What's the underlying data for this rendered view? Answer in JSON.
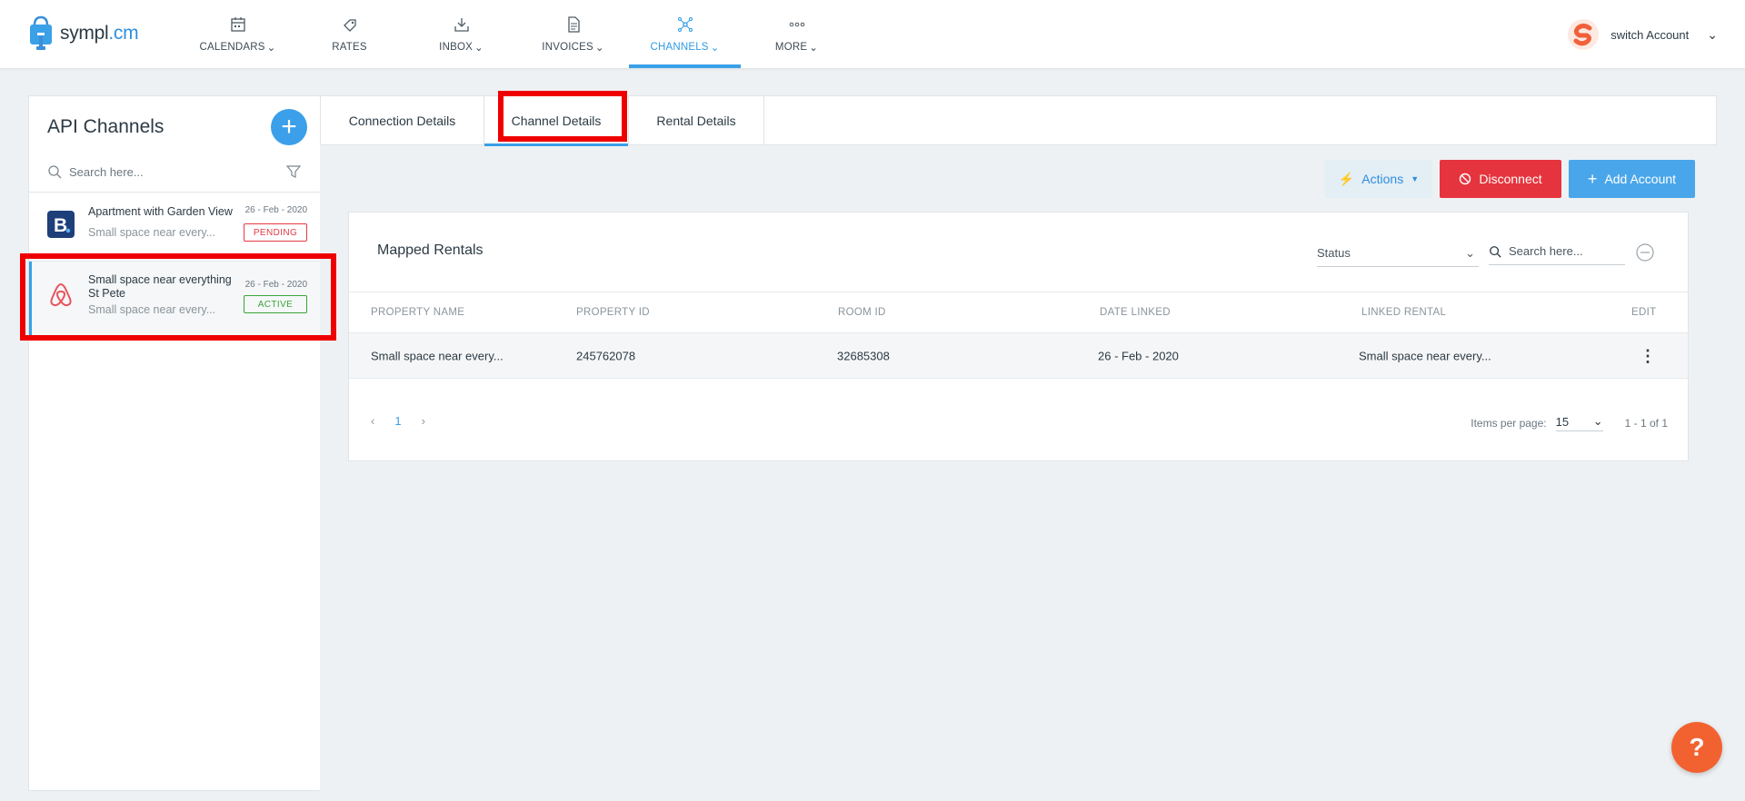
{
  "brand": {
    "name_main": "sympl",
    "name_suffix": ".cm"
  },
  "nav": [
    {
      "label": "CALENDARS",
      "icon": "calendar-icon",
      "dropdown": true,
      "active": false
    },
    {
      "label": "RATES",
      "icon": "tag-icon",
      "dropdown": false,
      "active": false
    },
    {
      "label": "INBOX",
      "icon": "inbox-download-icon",
      "dropdown": true,
      "active": false
    },
    {
      "label": "INVOICES",
      "icon": "document-icon",
      "dropdown": true,
      "active": false
    },
    {
      "label": "CHANNELS",
      "icon": "network-icon",
      "dropdown": true,
      "active": true
    },
    {
      "label": "MORE",
      "icon": "more-dots-icon",
      "dropdown": true,
      "active": false
    }
  ],
  "account": {
    "label": "switch Account"
  },
  "sidebar": {
    "title": "API Channels",
    "search_placeholder": "Search here...",
    "channels": [
      {
        "name": "Apartment with Garden View",
        "subtitle": "Small space near every...",
        "date": "26 - Feb - 2020",
        "status": "PENDING",
        "icon": "booking-icon"
      },
      {
        "name": "Small space near everything St Pete",
        "subtitle": "Small space near every...",
        "date": "26 - Feb - 2020",
        "status": "ACTIVE",
        "icon": "airbnb-icon"
      }
    ]
  },
  "tabs": [
    "Connection Details",
    "Channel Details",
    "Rental Details"
  ],
  "toolbar": {
    "actions": "Actions",
    "disconnect": "Disconnect",
    "add_account": "Add Account"
  },
  "mapped": {
    "title": "Mapped Rentals",
    "status_label": "Status",
    "search_placeholder": "Search here...",
    "columns": [
      "PROPERTY NAME",
      "PROPERTY ID",
      "ROOM ID",
      "DATE LINKED",
      "LINKED RENTAL",
      "EDIT"
    ],
    "rows": [
      {
        "property_name": "Small space near every...",
        "property_id": "245762078",
        "room_id": "32685308",
        "date_linked": "26 - Feb - 2020",
        "linked_rental": "Small space near every..."
      }
    ],
    "pagination": {
      "page": "1",
      "items_per_page_label": "Items per page:",
      "items_per_page": "15",
      "range": "1 - 1 of 1"
    }
  },
  "colors": {
    "accent": "#3aa0e8",
    "danger": "#e5343d",
    "highlight": "#ef0000",
    "help": "#f26230"
  }
}
